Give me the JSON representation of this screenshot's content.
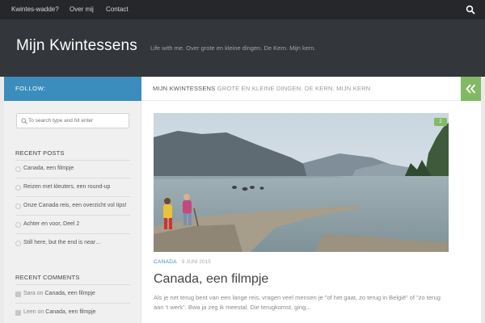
{
  "topnav": {
    "items": [
      "Kwintes-wadde?",
      "Over mij",
      "Contact"
    ],
    "search_icon": "search-icon"
  },
  "header": {
    "title": "Mijn Kwintessens",
    "tagline": "Life with me. Over grote en kleine dingen. De Kern. Mijn kern."
  },
  "sidebar": {
    "follow_label": "FOLLOW:",
    "search_placeholder": "To search type and hit enter",
    "recent_posts_title": "RECENT POSTS",
    "recent_posts": [
      "Canada, een filmpje",
      "Reizen met kleuters, een round-up",
      "Onze Canada reis, een overzicht vol tips!",
      "Achter en voor, Deel 2",
      "Still here, but the end is near…"
    ],
    "recent_comments_title": "RECENT COMMENTS",
    "recent_comments": [
      {
        "author": "Sara",
        "on": "on",
        "post": "Canada, een filmpje"
      },
      {
        "author": "Leen",
        "on": "on",
        "post": "Canada, een filmpje"
      }
    ]
  },
  "content": {
    "breadcrumb_site": "MIJN KWINTESSENS",
    "breadcrumb_tagline": "GROTE EN KLEINE DINGEN. DE KERN. MIJN KERN",
    "toggle_icon": "double-chevron-left-icon",
    "post": {
      "comment_count": "2",
      "category": "CANADA",
      "date": "9 JUNI 2015",
      "title": "Canada, een filmpje",
      "excerpt": "Als je net terug bent van een lange reis, vragen veel mensen je \"of het gaat, zo terug in België\" of \"zo terug aan 't werk\". Bwa ja zeg ik meestal. Die terugkomst, ging..."
    }
  },
  "colors": {
    "topnav_bg": "#26272b",
    "header_bg": "#33363b",
    "accent_blue": "#3b8dbd",
    "accent_green": "#82b965"
  }
}
